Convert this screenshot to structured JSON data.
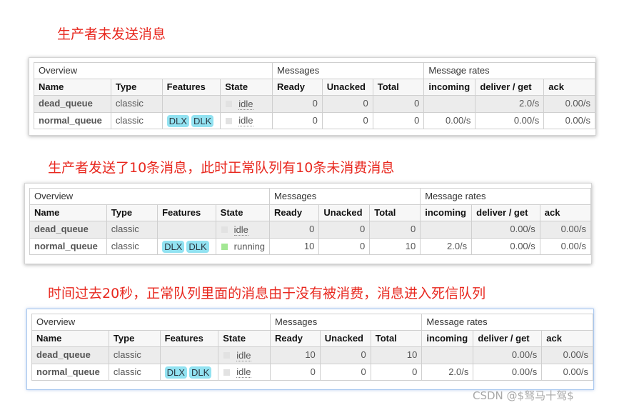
{
  "panels": [
    {
      "heading": "生产者未发送消息",
      "group_overview": "Overview",
      "group_messages": "Messages",
      "group_rates": "Message rates",
      "columns": {
        "name": "Name",
        "type": "Type",
        "features": "Features",
        "state": "State",
        "ready": "Ready",
        "unacked": "Unacked",
        "total": "Total",
        "incoming": "incoming",
        "deliver_get": "deliver / get",
        "ack": "ack"
      },
      "rows": [
        {
          "name": "dead_queue",
          "type": "classic",
          "features": [],
          "state": "idle",
          "state_color": "#e2e2e2",
          "ready": "0",
          "unacked": "0",
          "total": "0",
          "incoming": "",
          "deliver_get": "2.0/s",
          "ack": "0.00/s"
        },
        {
          "name": "normal_queue",
          "type": "classic",
          "features": [
            "DLX",
            "DLK"
          ],
          "state": "idle",
          "state_color": "#e2e2e2",
          "ready": "0",
          "unacked": "0",
          "total": "0",
          "incoming": "0.00/s",
          "deliver_get": "0.00/s",
          "ack": "0.00/s"
        }
      ]
    },
    {
      "heading": "生产者发送了10条消息，此时正常队列有10条未消费消息",
      "group_overview": "Overview",
      "group_messages": "Messages",
      "group_rates": "Message rates",
      "columns": {
        "name": "Name",
        "type": "Type",
        "features": "Features",
        "state": "State",
        "ready": "Ready",
        "unacked": "Unacked",
        "total": "Total",
        "incoming": "incoming",
        "deliver_get": "deliver / get",
        "ack": "ack"
      },
      "rows": [
        {
          "name": "dead_queue",
          "type": "classic",
          "features": [],
          "state": "idle",
          "state_color": "#e2e2e2",
          "ready": "0",
          "unacked": "0",
          "total": "0",
          "incoming": "",
          "deliver_get": "0.00/s",
          "ack": "0.00/s"
        },
        {
          "name": "normal_queue",
          "type": "classic",
          "features": [
            "DLX",
            "DLK"
          ],
          "state": "running",
          "state_color": "#a3e794",
          "ready": "10",
          "unacked": "0",
          "total": "10",
          "incoming": "2.0/s",
          "deliver_get": "0.00/s",
          "ack": "0.00/s"
        }
      ]
    },
    {
      "heading": "时间过去20秒，正常队列里面的消息由于没有被消费，消息进入死信队列",
      "group_overview": "Overview",
      "group_messages": "Messages",
      "group_rates": "Message rates",
      "columns": {
        "name": "Name",
        "type": "Type",
        "features": "Features",
        "state": "State",
        "ready": "Ready",
        "unacked": "Unacked",
        "total": "Total",
        "incoming": "incoming",
        "deliver_get": "deliver / get",
        "ack": "ack"
      },
      "rows": [
        {
          "name": "dead_queue",
          "type": "classic",
          "features": [],
          "state": "idle",
          "state_color": "#e2e2e2",
          "ready": "10",
          "unacked": "0",
          "total": "10",
          "incoming": "",
          "deliver_get": "0.00/s",
          "ack": "0.00/s"
        },
        {
          "name": "normal_queue",
          "type": "classic",
          "features": [
            "DLX",
            "DLK"
          ],
          "state": "idle",
          "state_color": "#e2e2e2",
          "ready": "0",
          "unacked": "0",
          "total": "0",
          "incoming": "2.0/s",
          "deliver_get": "0.00/s",
          "ack": "0.00/s"
        }
      ]
    }
  ],
  "watermark": "CSDN @$驽马十驾$"
}
